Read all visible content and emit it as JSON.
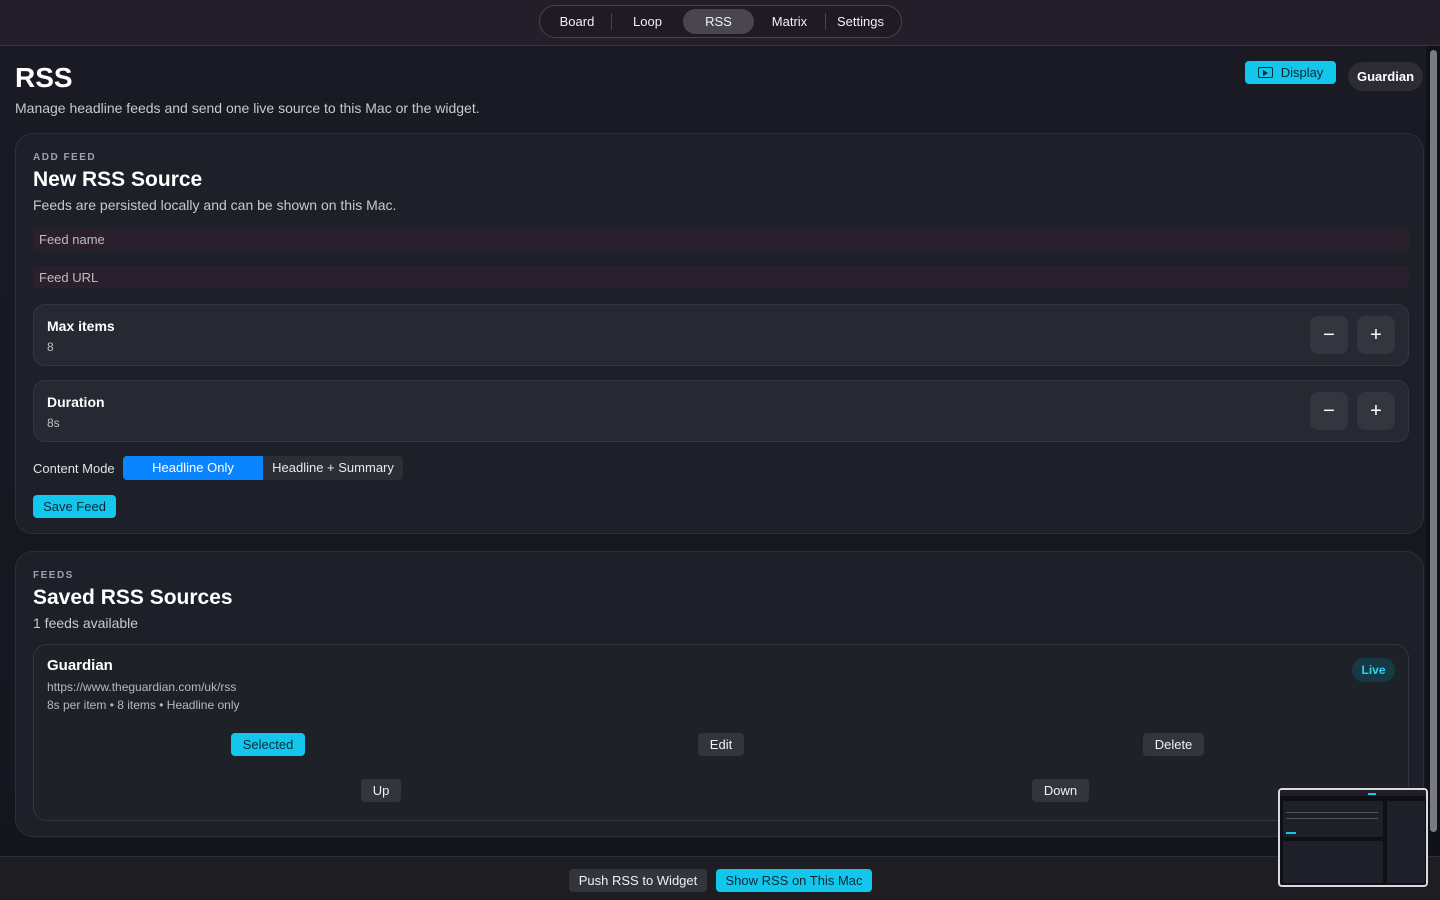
{
  "nav": {
    "tabs": [
      "Board",
      "Loop",
      "RSS",
      "Matrix",
      "Settings"
    ],
    "active": "RSS"
  },
  "header": {
    "title": "RSS",
    "subtitle": "Manage headline feeds and send one live source to this Mac or the widget.",
    "display_button": "Display",
    "active_source": "Guardian"
  },
  "add_feed": {
    "eyebrow": "ADD FEED",
    "title": "New RSS Source",
    "subtitle": "Feeds are persisted locally and can be shown on this Mac.",
    "name_placeholder": "Feed name",
    "url_placeholder": "Feed URL",
    "max_items": {
      "label": "Max items",
      "value": "8",
      "minus": "−",
      "plus": "+"
    },
    "duration": {
      "label": "Duration",
      "value": "8s",
      "minus": "−",
      "plus": "+"
    },
    "content_mode": {
      "label": "Content Mode",
      "options": [
        "Headline Only",
        "Headline + Summary"
      ],
      "selected": "Headline Only"
    },
    "save_button": "Save Feed"
  },
  "feeds": {
    "eyebrow": "FEEDS",
    "title": "Saved RSS Sources",
    "count_text": "1 feeds available",
    "items": [
      {
        "name": "Guardian",
        "url": "https://www.theguardian.com/uk/rss",
        "meta": "8s per item • 8 items • Headline only",
        "badge": "Live",
        "selected_label": "Selected",
        "edit_label": "Edit",
        "delete_label": "Delete",
        "up_label": "Up",
        "down_label": "Down"
      }
    ]
  },
  "bottom": {
    "push_button": "Push RSS to Widget",
    "show_button": "Show RSS on This Mac"
  },
  "colors": {
    "accent_cyan": "#13c6ec",
    "segment_blue": "#0a84ff",
    "background": "#14161e"
  }
}
